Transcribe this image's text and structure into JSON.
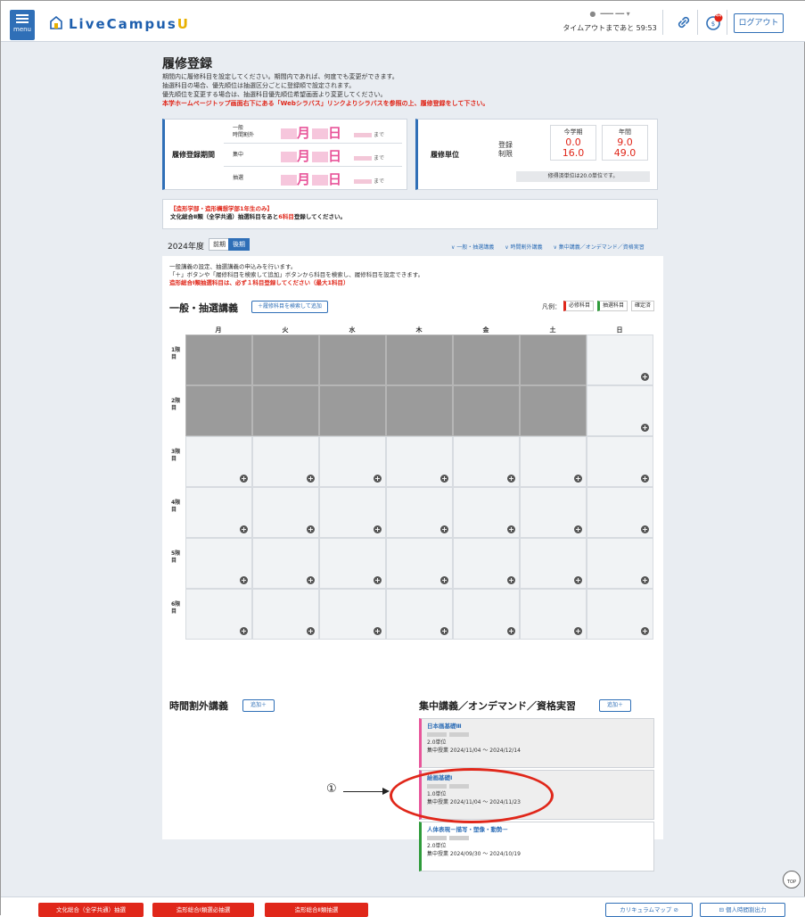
{
  "header": {
    "menu_label": "menu",
    "logo_text_main": "LiveCampus",
    "logo_text_accent": "U",
    "timeout_text": "タイムアウトまであと 59:53",
    "logout_label": "ログアウト",
    "notify_count": "44"
  },
  "page": {
    "title": "履修登録",
    "intro_lines": [
      "期間内に履修科目を設定してください。期間内であれば、何度でも変更ができます。",
      "抽選科目の場合、優先順位は抽選区分ごとに登録順で設定されます。",
      "優先順位を変更する場合は、抽選科目優先順位希望画面より変更してください。"
    ],
    "intro_red": "本学ホームページトップ画面右下にある「Webシラバス」リンクよりシラバスを参照の上、履修登録をして下さい。"
  },
  "period_box": {
    "label": "履修登録期間",
    "rows": [
      {
        "name": "一般\n時間割外",
        "month": "月",
        "day": "日",
        "until": "まで"
      },
      {
        "name": "集中",
        "month": "月",
        "day": "日",
        "until": "まで"
      },
      {
        "name": "抽選",
        "month": "月",
        "day": "日",
        "until": "まで"
      }
    ]
  },
  "units_box": {
    "label": "履修単位",
    "row_labels": [
      "登録",
      "制限"
    ],
    "col_this": "今学期",
    "col_year": "年間",
    "this_reg": "0.0",
    "this_lim": "16.0",
    "year_reg": "9.0",
    "year_lim": "49.0",
    "note": "修得済単位は20.0単位です。"
  },
  "alert": {
    "line1": "【造形学部・造形構想学部1年生のみ】",
    "line2_pre": "文化総合Ⅱ類（全学共通）抽選科目をあと",
    "line2_num": "6科目",
    "line2_post": "登録してください。"
  },
  "terms": {
    "year": "2024年度",
    "first": "前期",
    "second": "後期"
  },
  "anchors": [
    "∨ 一般・抽選講義",
    "∨ 時間割外講義",
    "∨ 集中講義／オンデマンド／資格実習"
  ],
  "timetable": {
    "intro1": "一般講義の設定、抽選講義の申込みを行います。",
    "intro2": "「＋」ボタンや「履修科目を検索して追加」ボタンから科目を検索し、履修科目を設定できます。",
    "intro_red": "造形総合Ⅰ類抽選科目は、必ず１科目登録してください（最大1科目）",
    "section_title": "一般・抽選講義",
    "search_add": "＋履修科目を検索して追加",
    "legend_label": "凡例：",
    "legend_req": "必修科目",
    "legend_lot": "抽選科目",
    "legend_fixed": "確定済",
    "days": [
      "月",
      "火",
      "水",
      "木",
      "金",
      "土",
      "日"
    ],
    "periods": [
      "1限目",
      "2限目",
      "3限目",
      "4限目",
      "5限目",
      "6限目"
    ],
    "plus": "+"
  },
  "offtime": {
    "title": "時間割外講義",
    "add": "追加＋"
  },
  "intensive": {
    "title": "集中講義／オンデマンド／資格実習",
    "add": "追加＋",
    "courses": [
      {
        "name": "日本画基礎Ⅲ",
        "units": "2.0単位",
        "period": "集中授業 2024/11/04 ～ 2024/12/14"
      },
      {
        "name": "絵画基礎Ⅰ",
        "units": "1.0単位",
        "period": "集中授業 2024/11/04 ～ 2024/11/23"
      },
      {
        "name": "人体表現－描写・塑像・動勢－",
        "units": "2.0単位",
        "period": "集中授業 2024/09/30 ～ 2024/10/19"
      }
    ]
  },
  "annotation": {
    "number": "①"
  },
  "footer": {
    "btn1": "文化総合（全学共通）抽選",
    "btn2": "造形総合Ⅰ類選必抽選",
    "btn3": "造形総合Ⅱ類抽選",
    "btn4": "カリキュラムマップ ⊘",
    "btn5": "⊟ 個人時間割出力"
  },
  "top_button": "TOP",
  "colors": {
    "accent": "#2f6fb7",
    "alert": "#e0271a",
    "date_pink": "#e8559a"
  }
}
